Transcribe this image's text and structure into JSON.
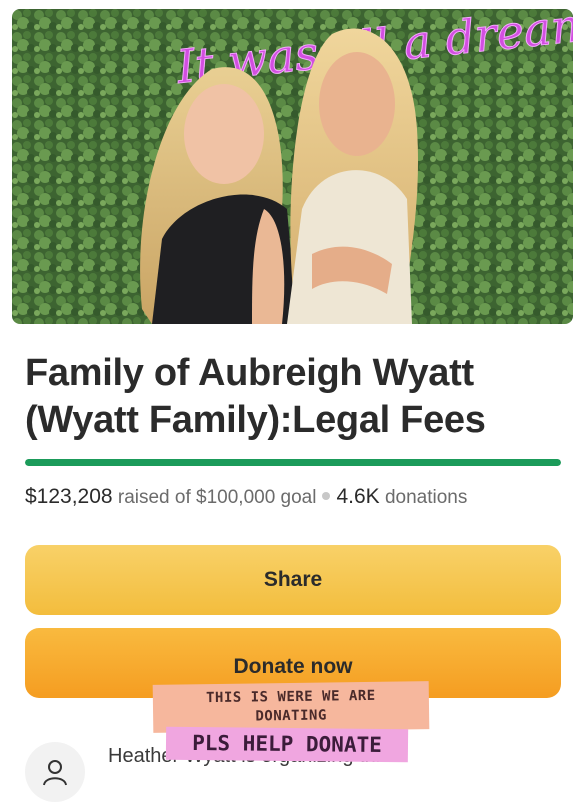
{
  "hero": {
    "neon_sign_text": "It was all a dream",
    "colors": {
      "foliage": "#3f6b34",
      "neon": "#d24fe0"
    }
  },
  "campaign": {
    "title": "Family of Aubreigh Wyatt (Wyatt Family):Legal Fees",
    "raised": "$123,208",
    "goal_text": "raised of $100,000 goal",
    "donations_count": "4.6K",
    "donations_label": "donations",
    "progress_fraction": 1.0,
    "progress_color": "#1b9b5a"
  },
  "buttons": {
    "share_label": "Share",
    "donate_label": "Donate now"
  },
  "organizer": {
    "text": "Heather Wyatt is organizing this"
  },
  "stickers": {
    "line1": "THIS IS WERE WE ARE",
    "line2": "DONATING",
    "help": "PLS HELP DONATE"
  }
}
